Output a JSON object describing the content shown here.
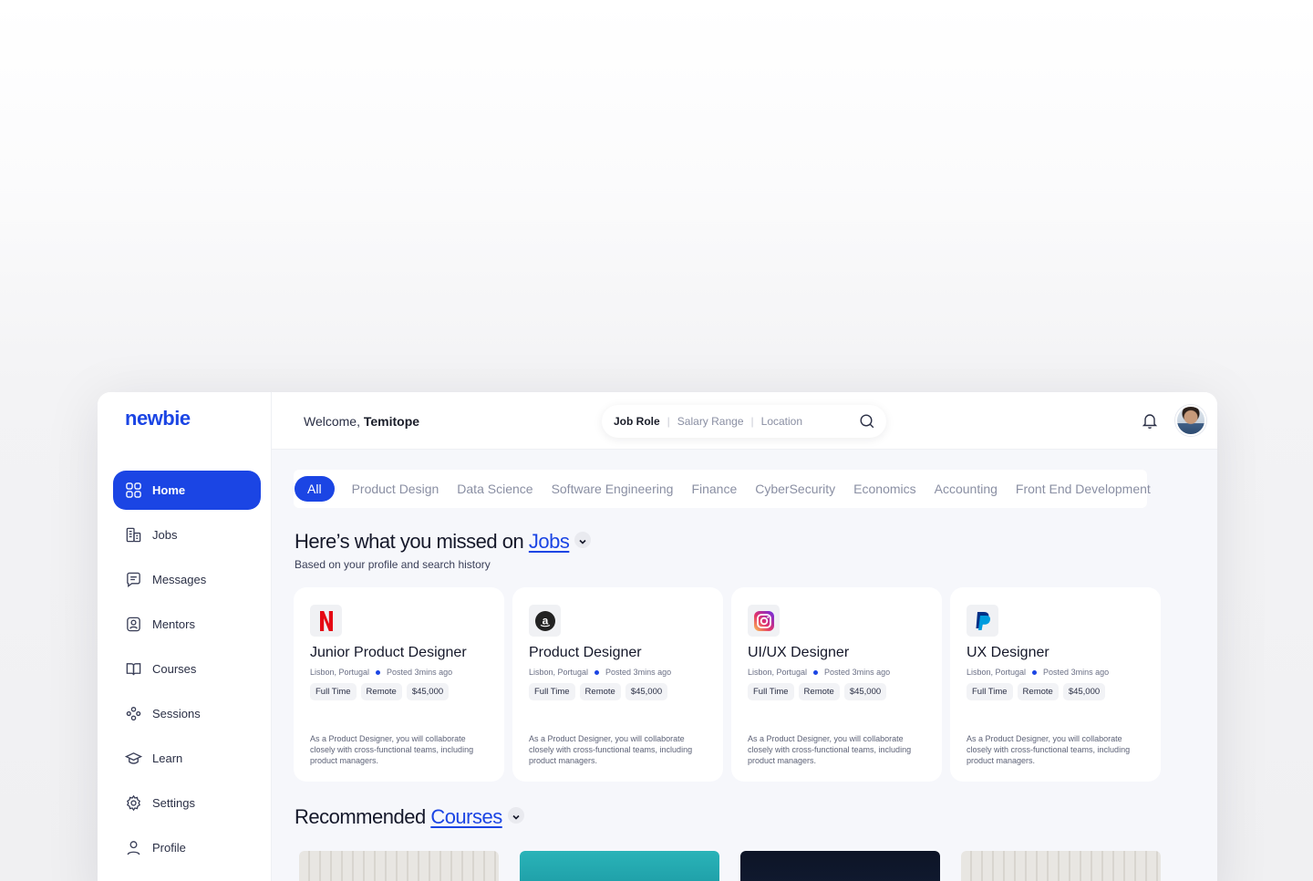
{
  "app": {
    "logo": "newbie"
  },
  "sidebar": {
    "items": [
      {
        "label": "Home",
        "icon": "grid-icon",
        "active": true
      },
      {
        "label": "Jobs",
        "icon": "building-icon"
      },
      {
        "label": "Messages",
        "icon": "chat-icon"
      },
      {
        "label": "Mentors",
        "icon": "mentor-icon"
      },
      {
        "label": "Courses",
        "icon": "book-icon"
      },
      {
        "label": "Sessions",
        "icon": "people-icon"
      },
      {
        "label": "Learn",
        "icon": "graduation-icon"
      },
      {
        "label": "Settings",
        "icon": "gear-icon"
      },
      {
        "label": "Profile",
        "icon": "user-icon"
      }
    ]
  },
  "header": {
    "welcome_prefix": "Welcome,",
    "user_name": "Temitope",
    "search": {
      "job_role": "Job Role",
      "salary_range": "Salary Range",
      "location": "Location"
    }
  },
  "filters": [
    "All",
    "Product Design",
    "Data Science",
    "Software Engineering",
    "Finance",
    "CyberSecurity",
    "Economics",
    "Accounting",
    "Front End Development"
  ],
  "jobs_section": {
    "title_prefix": "Here’s what you missed on",
    "title_link": "Jobs",
    "subtitle": "Based on your profile and search history",
    "cards": [
      {
        "company": "netflix-logo",
        "title": "Junior Product Designer",
        "location": "Lisbon, Portugal",
        "posted": "Posted 3mins ago",
        "tags": [
          "Full Time",
          "Remote",
          "$45,000"
        ],
        "description": "As a Product Designer, you will collaborate closely with cross-functional teams, including product managers."
      },
      {
        "company": "amazon-logo",
        "title": "Product Designer",
        "location": "Lisbon, Portugal",
        "posted": "Posted 3mins ago",
        "tags": [
          "Full Time",
          "Remote",
          "$45,000"
        ],
        "description": "As a Product Designer, you will collaborate closely with cross-functional teams, including product managers."
      },
      {
        "company": "instagram-logo",
        "title": "UI/UX Designer",
        "location": "Lisbon, Portugal",
        "posted": "Posted 3mins ago",
        "tags": [
          "Full Time",
          "Remote",
          "$45,000"
        ],
        "description": "As a Product Designer, you will collaborate closely with cross-functional teams, including product managers."
      },
      {
        "company": "paypal-logo",
        "title": "UX Designer",
        "location": "Lisbon, Portugal",
        "posted": "Posted 3mins ago",
        "tags": [
          "Full Time",
          "Remote",
          "$45,000"
        ],
        "description": "As a Product Designer, you will collaborate closely with cross-functional teams, including product managers."
      }
    ]
  },
  "courses_section": {
    "title_prefix": "Recommended",
    "title_link": "Courses"
  },
  "colors": {
    "accent": "#1b45e4",
    "text": "#15182a",
    "muted": "#8a8fa3"
  }
}
